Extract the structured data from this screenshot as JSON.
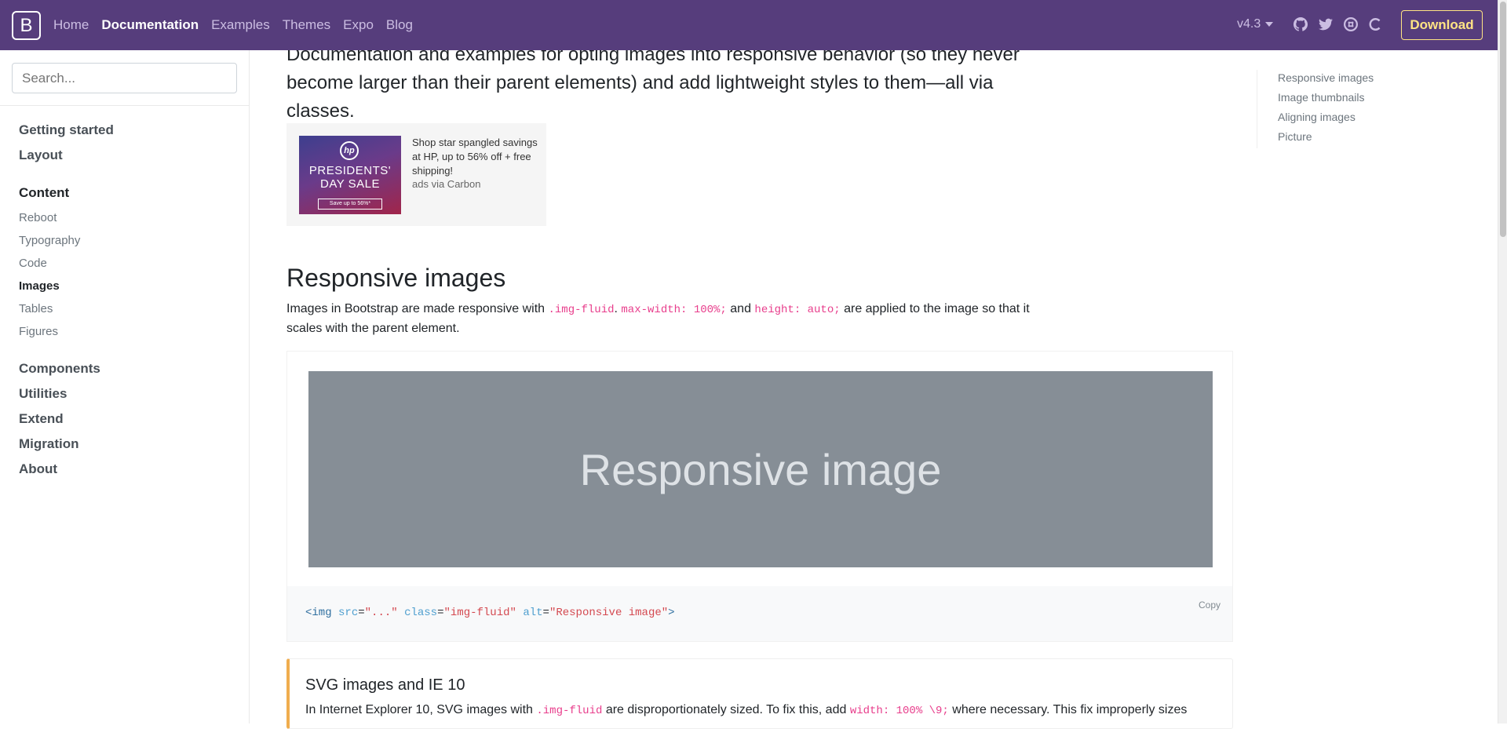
{
  "navbar": {
    "brand": "B",
    "links": [
      "Home",
      "Documentation",
      "Examples",
      "Themes",
      "Expo",
      "Blog"
    ],
    "version": "v4.3",
    "download_label": "Download",
    "icons": [
      "github-icon",
      "twitter-icon",
      "slack-icon",
      "opencollective-icon"
    ]
  },
  "sidebar": {
    "search_placeholder": "Search...",
    "groups_top": [
      "Getting started",
      "Layout"
    ],
    "content_group": "Content",
    "content_items": [
      "Reboot",
      "Typography",
      "Code",
      "Images",
      "Tables",
      "Figures"
    ],
    "active_item": "Images",
    "groups_bottom": [
      "Components",
      "Utilities",
      "Extend",
      "Migration",
      "About"
    ]
  },
  "main": {
    "lead": "Documentation and examples for opting images into responsive behavior (so they never become larger than their parent elements) and add lightweight styles to them—all via classes.",
    "ad": {
      "image_headline": "PRESIDENTS' DAY SALE",
      "image_button": "Save up to 56%*",
      "image_logo": "hp",
      "text": "Shop star spangled savings at HP, up to 56% off + free shipping!",
      "via": "ads via Carbon"
    },
    "section_title": "Responsive images",
    "para": {
      "t1": "Images in Bootstrap are made responsive with ",
      "c1": ".img-fluid",
      "t2": ". ",
      "c2": "max-width: 100%;",
      "t3": " and ",
      "c3": "height: auto;",
      "t4": " are applied to the image so that it scales with the parent element."
    },
    "placeholder_text": "Responsive image",
    "copy_label": "Copy",
    "code": {
      "open": "<img",
      "attr1": "src",
      "val1": "\"...\"",
      "attr2": "class",
      "val2": "\"img-fluid\"",
      "attr3": "alt",
      "val3": "\"Responsive image\"",
      "close": ">"
    },
    "callout": {
      "title": "SVG images and IE 10",
      "t1": "In Internet Explorer 10, SVG images with ",
      "c1": ".img-fluid",
      "t2": " are disproportionately sized. To fix this, add ",
      "c2": "width: 100% \\9;",
      "t3": " where necessary. This fix improperly sizes"
    }
  },
  "toc": {
    "items": [
      "Responsive images",
      "Image thumbnails",
      "Aligning images",
      "Picture"
    ]
  },
  "colors": {
    "navbar": "#563d7c",
    "download": "#ffe484",
    "code_pink": "#e83e8c",
    "placeholder": "#868e96",
    "callout_border": "#f0ad4e"
  }
}
